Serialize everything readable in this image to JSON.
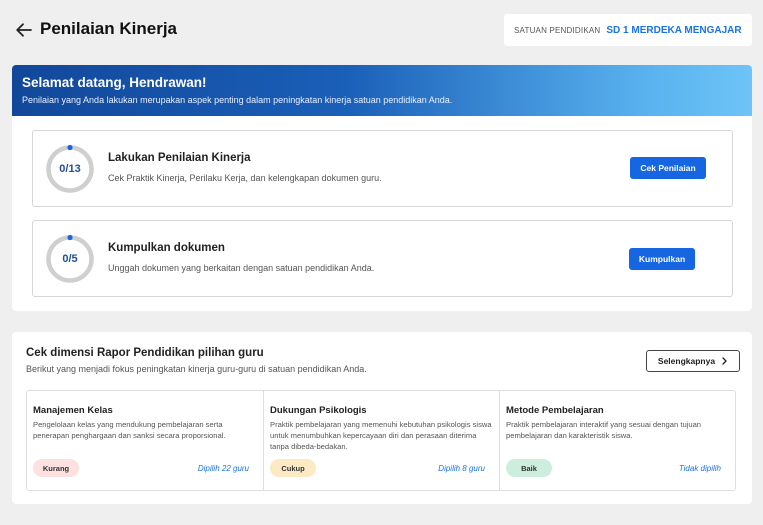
{
  "header": {
    "title": "Penilaian Kinerja",
    "school_label": "SATUAN PENDIDIKAN",
    "school_name": "SD 1 MERDEKA MENGAJAR"
  },
  "welcome": {
    "title": "Selamat datang, Hendrawan!",
    "subtitle": "Penilaian yang Anda lakukan merupakan aspek penting dalam peningkatan kinerja satuan pendidikan Anda."
  },
  "tasks": [
    {
      "progress_text": "0/13",
      "progress_fraction": 0,
      "title": "Lakukan Penilaian Kinerja",
      "description": "Cek Praktik Kinerja, Perilaku Kerja, dan kelengkapan dokumen guru.",
      "button_label": "Cek Penilaian"
    },
    {
      "progress_text": "0/5",
      "progress_fraction": 0,
      "title": "Kumpulkan dokumen",
      "description": "Unggah dokumen yang berkaitan dengan satuan pendidikan Anda.",
      "button_label": "Kumpulkan"
    }
  ],
  "rapor": {
    "title": "Cek dimensi Rapor Pendidikan pilihan guru",
    "subtitle": "Berikut yang menjadi fokus peningkatan kinerja guru-guru di satuan pendidikan Anda.",
    "more_button": "Selengkapnya",
    "dimensions": [
      {
        "title": "Manajemen Kelas",
        "description": "Pengelolaan kelas yang mendukung pembelajaran serta penerapan penghargaan dan sanksi secara proporsional.",
        "status": "Kurang",
        "status_color": "#fde0e0",
        "count": "Dipilih 22 guru"
      },
      {
        "title": "Dukungan Psikologis",
        "description": "Praktik pembelajaran yang memenuhi kebutuhan psikologis siswa untuk menumbuhkan kepercayaan diri dan perasaan diterima tanpa dibeda-bedakan.",
        "status": "Cukup",
        "status_color": "#fde9c4",
        "count": "Dipilih 8 guru"
      },
      {
        "title": "Metode Pembelajaran",
        "description": "Praktik pembelajaran interaktif yang sesuai dengan tujuan pembelajaran dan karakteristik siswa.",
        "status": "Baik",
        "status_color": "#cdeedd",
        "count": "Tidak dipilih"
      }
    ]
  },
  "colors": {
    "primary": "#1566e0",
    "link": "#1a73e8",
    "ring_track": "#cfcfcf",
    "ring_accent": "#1566e0"
  },
  "icons": [
    "arrow-left-icon",
    "chevron-right-icon"
  ]
}
